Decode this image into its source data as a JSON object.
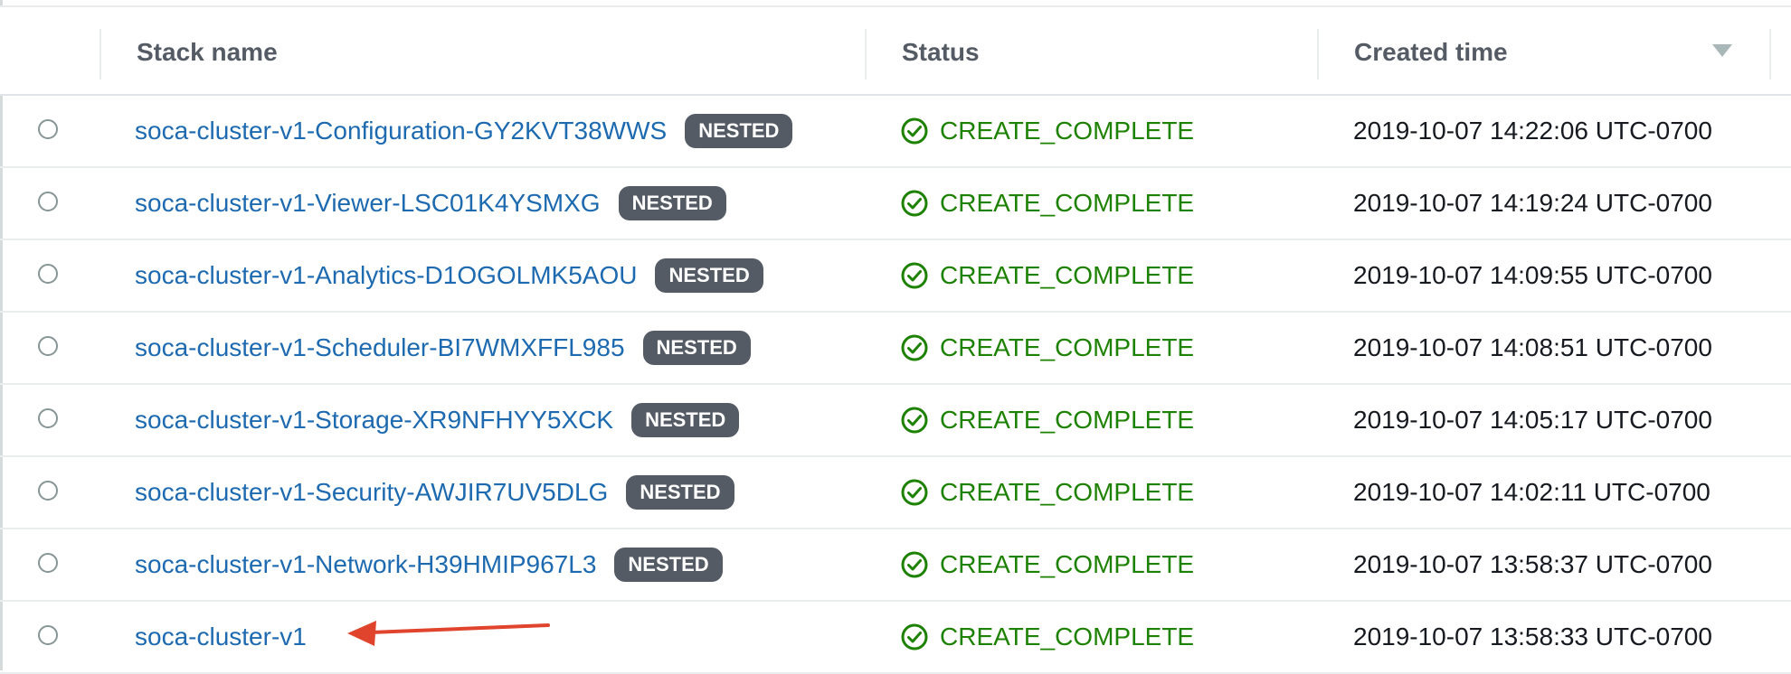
{
  "table": {
    "columns": [
      {
        "key": "stack_name",
        "label": "Stack name"
      },
      {
        "key": "status",
        "label": "Status"
      },
      {
        "key": "created_time",
        "label": "Created time"
      }
    ],
    "sort": {
      "column": "Created time",
      "direction": "descending",
      "icon": "sort-down-triangle-icon"
    },
    "rows": [
      {
        "name": "soca-cluster-v1-Configuration-GY2KVT38WWS",
        "badge": "NESTED",
        "status": "CREATE_COMPLETE",
        "created": "2019-10-07 14:22:06 UTC-0700"
      },
      {
        "name": "soca-cluster-v1-Viewer-LSC01K4YSMXG",
        "badge": "NESTED",
        "status": "CREATE_COMPLETE",
        "created": "2019-10-07 14:19:24 UTC-0700"
      },
      {
        "name": "soca-cluster-v1-Analytics-D1OGOLMK5AOU",
        "badge": "NESTED",
        "status": "CREATE_COMPLETE",
        "created": "2019-10-07 14:09:55 UTC-0700"
      },
      {
        "name": "soca-cluster-v1-Scheduler-BI7WMXFFL985",
        "badge": "NESTED",
        "status": "CREATE_COMPLETE",
        "created": "2019-10-07 14:08:51 UTC-0700"
      },
      {
        "name": "soca-cluster-v1-Storage-XR9NFHYY5XCK",
        "badge": "NESTED",
        "status": "CREATE_COMPLETE",
        "created": "2019-10-07 14:05:17 UTC-0700"
      },
      {
        "name": "soca-cluster-v1-Security-AWJIR7UV5DLG",
        "badge": "NESTED",
        "status": "CREATE_COMPLETE",
        "created": "2019-10-07 14:02:11 UTC-0700"
      },
      {
        "name": "soca-cluster-v1-Network-H39HMIP967L3",
        "badge": "NESTED",
        "status": "CREATE_COMPLETE",
        "created": "2019-10-07 13:58:37 UTC-0700"
      },
      {
        "name": "soca-cluster-v1",
        "badge": "",
        "status": "CREATE_COMPLETE",
        "created": "2019-10-07 13:58:33 UTC-0700"
      }
    ]
  },
  "colors": {
    "link": "#1d6ab0",
    "success": "#1d8102",
    "badge_bg": "#545b64",
    "annotation_arrow": "#e0442c"
  },
  "icons": {
    "status": "check-circle-icon",
    "annotation": "red-arrow-icon"
  }
}
